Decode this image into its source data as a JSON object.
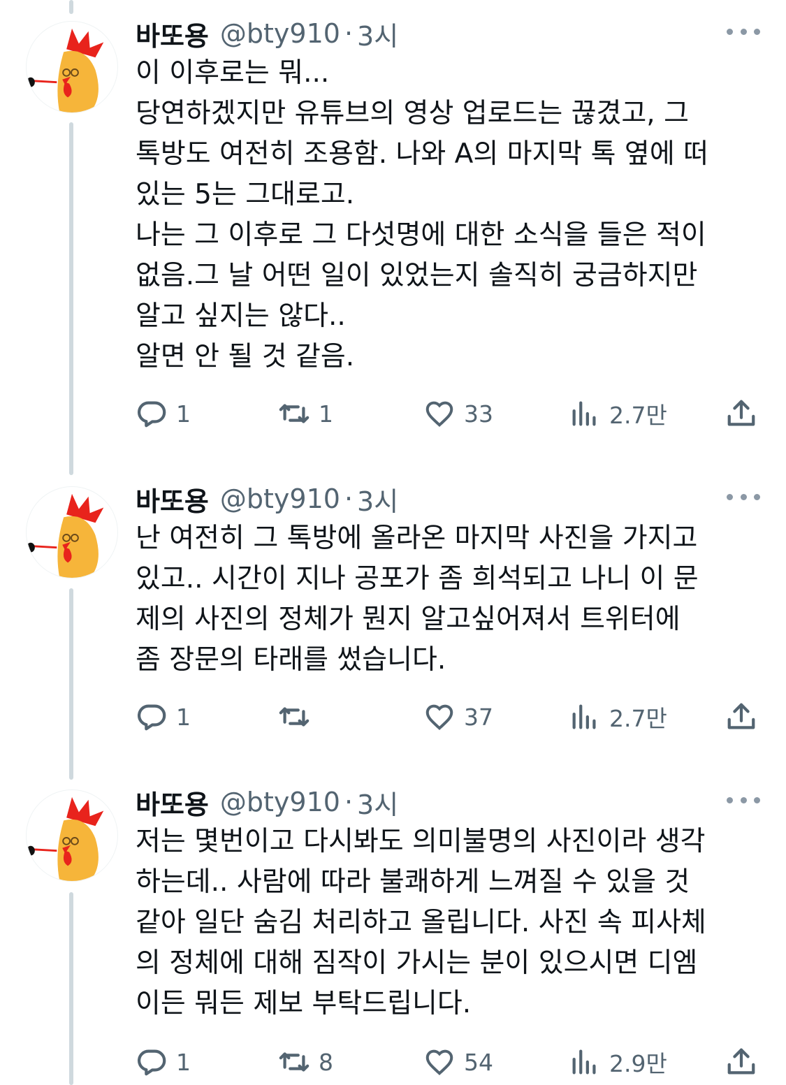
{
  "tweets": [
    {
      "author": "바또용",
      "handle": "@bty910",
      "separator": "·",
      "time": "3시",
      "text": "이 이후로는 뭐...\n당연하겠지만 유튜브의 영상 업로드는 끊겼고, 그\n톡방도 여전히 조용함. 나와 A의 마지막 톡 옆에 떠\n있는 5는 그대로고.\n나는 그 이후로 그 다섯명에 대한 소식을 들은 적이\n없음.그 날 어떤 일이 있었는지 솔직히 궁금하지만\n알고 싶지는 않다..\n알면 안 될 것 같음.",
      "replies": "1",
      "retweets": "1",
      "likes": "33",
      "views": "2.7만"
    },
    {
      "author": "바또용",
      "handle": "@bty910",
      "separator": "·",
      "time": "3시",
      "text": "난 여전히 그 톡방에 올라온 마지막 사진을 가지고\n있고.. 시간이 지나 공포가 좀 희석되고 나니 이 문\n제의 사진의 정체가 뭔지 알고싶어져서 트위터에\n좀 장문의 타래를 썼습니다.",
      "replies": "1",
      "retweets": "",
      "likes": "37",
      "views": "2.7만"
    },
    {
      "author": "바또용",
      "handle": "@bty910",
      "separator": "·",
      "time": "3시",
      "text": "저는 몇번이고 다시봐도 의미불명의 사진이라 생각\n하는데.. 사람에 따라 불쾌하게 느껴질 수 있을 것\n같아 일단 숨김 처리하고 올립니다. 사진 속 피사체\n의 정체에 대해 짐작이 가시는 분이 있으시면 디엠\n이든 뭐든 제보 부탁드립니다.",
      "replies": "1",
      "retweets": "8",
      "likes": "54",
      "views": "2.9만"
    }
  ],
  "icons": {
    "reply": "speech-bubble-icon",
    "retweet": "retweet-arrows-icon",
    "like": "heart-icon",
    "views": "bar-chart-icon",
    "share": "upload-arrow-icon",
    "more": "three-dots-icon",
    "avatar": "rooster-avatar"
  },
  "colors": {
    "text": "#0f1419",
    "secondary": "#536471",
    "thread_line": "#cfd9de",
    "rooster_comb": "#e8231c",
    "rooster_body": "#f6b53a"
  }
}
